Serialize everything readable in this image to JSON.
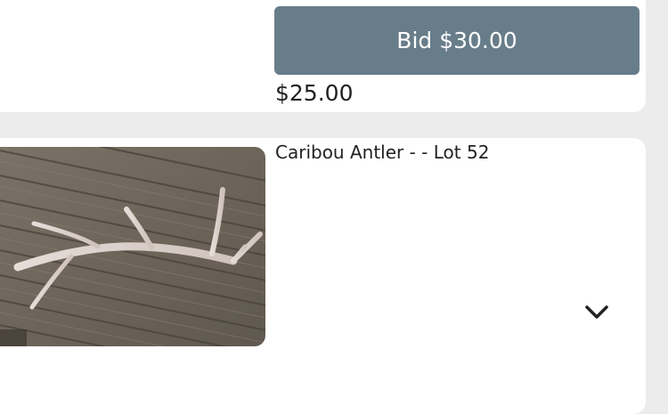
{
  "previous_lot": {
    "bid_button_label": "Bid $30.00",
    "current_price": "$25.00"
  },
  "lot": {
    "title": "Caribou Antler - - Lot 52",
    "image_subject": "antler on wooden deck",
    "expand_icon": "chevron-down-icon"
  },
  "colors": {
    "page_background": "#ececec",
    "card_background": "#ffffff",
    "bid_button": "#687d8a",
    "text": "#222222"
  }
}
